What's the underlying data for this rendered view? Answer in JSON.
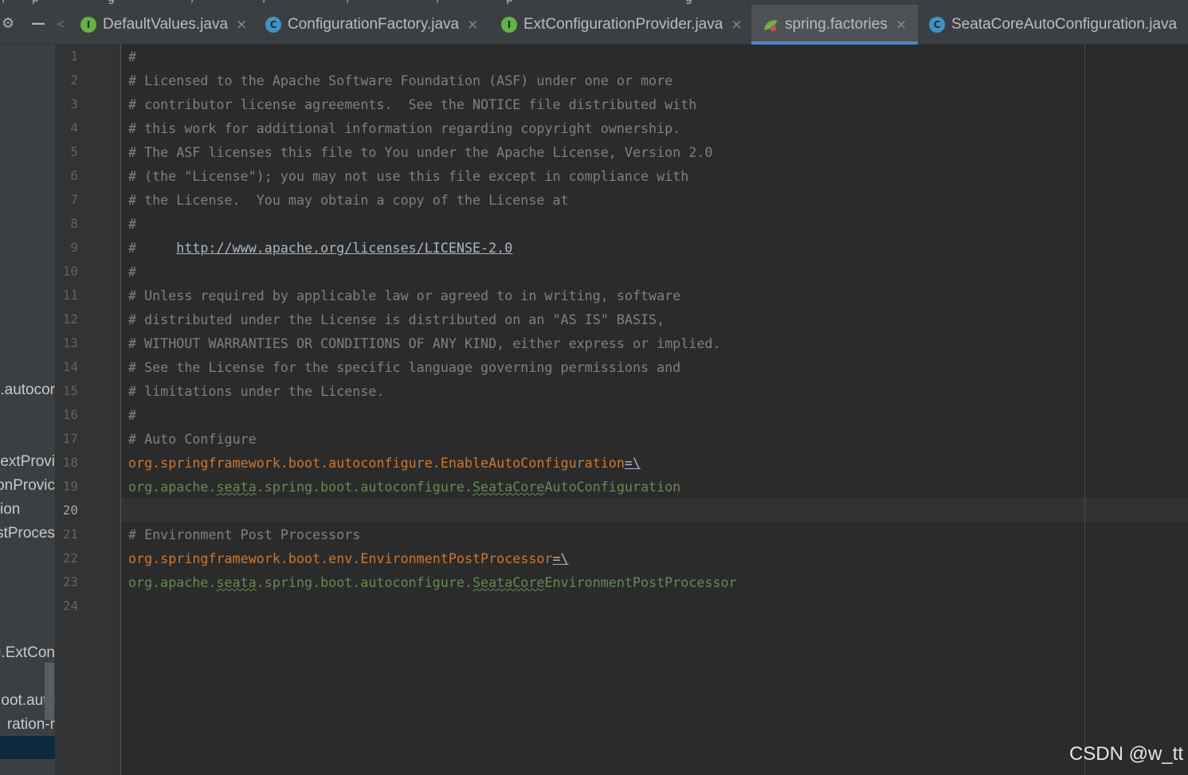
{
  "top_strip": [
    "/",
    "p",
    "g",
    "/",
    "/",
    "/",
    "/",
    "p",
    "g"
  ],
  "toolbar": {
    "settings_icon": "gear-icon",
    "collapse_icon": "minus-icon",
    "scroll_left_icon": "chevron-left-icon"
  },
  "tabs": [
    {
      "label": "DefaultValues.java",
      "icon": "I",
      "icon_color": "#62b543",
      "active": false
    },
    {
      "label": "ConfigurationFactory.java",
      "icon": "C",
      "icon_color": "#3d95c7",
      "active": false
    },
    {
      "label": "ExtConfigurationProvider.java",
      "icon": "I",
      "icon_color": "#62b543",
      "active": false
    },
    {
      "label": "spring.factories",
      "icon": "leaf",
      "icon_color": "#6db33f",
      "active": true
    },
    {
      "label": "SeataCoreAutoConfiguration.java",
      "icon": "C",
      "icon_color": "#3d95c7",
      "active": false
    }
  ],
  "close_glyph": "×",
  "sidebar": {
    "items": [
      {
        "text": ".autocor"
      },
      {
        "text": "extProvi"
      },
      {
        "text": "onProvic"
      },
      {
        "text": "ion"
      },
      {
        "text": "stProces"
      },
      {
        "text": "g.ExtCon"
      },
      {
        "text": "oot.autc"
      },
      {
        "text": "ration-r"
      }
    ]
  },
  "editor": {
    "current_line": 20,
    "line_numbers": [
      "1",
      "2",
      "3",
      "4",
      "5",
      "6",
      "7",
      "8",
      "9",
      "10",
      "11",
      "12",
      "13",
      "14",
      "15",
      "16",
      "17",
      "18",
      "19",
      "20",
      "21",
      "22",
      "23",
      "24"
    ],
    "lines": [
      {
        "segments": [
          {
            "t": "#",
            "c": "cm"
          }
        ]
      },
      {
        "segments": [
          {
            "t": "# Licensed to the Apache Software Foundation (ASF) under one or more",
            "c": "cm"
          }
        ]
      },
      {
        "segments": [
          {
            "t": "# contributor license agreements.  See the NOTICE file distributed with",
            "c": "cm"
          }
        ]
      },
      {
        "segments": [
          {
            "t": "# this work for additional information regarding copyright ownership.",
            "c": "cm"
          }
        ]
      },
      {
        "segments": [
          {
            "t": "# The ASF licenses this file to You under the Apache License, Version 2.0",
            "c": "cm"
          }
        ]
      },
      {
        "segments": [
          {
            "t": "# (the \"License\"); you may not use this file except in compliance with",
            "c": "cm"
          }
        ]
      },
      {
        "segments": [
          {
            "t": "# the License.  You may obtain a copy of the License at",
            "c": "cm"
          }
        ]
      },
      {
        "segments": [
          {
            "t": "#",
            "c": "cm"
          }
        ]
      },
      {
        "segments": [
          {
            "t": "#     ",
            "c": "cm"
          },
          {
            "t": "http://www.apache.org/licenses/LICENSE-2.0",
            "c": "url"
          }
        ]
      },
      {
        "segments": [
          {
            "t": "#",
            "c": "cm"
          }
        ]
      },
      {
        "segments": [
          {
            "t": "# Unless required by applicable law or agreed to in writing, software",
            "c": "cm"
          }
        ]
      },
      {
        "segments": [
          {
            "t": "# distributed under the License is distributed on an \"AS IS\" BASIS,",
            "c": "cm"
          }
        ]
      },
      {
        "segments": [
          {
            "t": "# WITHOUT WARRANTIES OR CONDITIONS OF ANY KIND, either express or implied.",
            "c": "cm"
          }
        ]
      },
      {
        "segments": [
          {
            "t": "# See the License for the specific language governing permissions and",
            "c": "cm"
          }
        ]
      },
      {
        "segments": [
          {
            "t": "# limitations under the License.",
            "c": "cm"
          }
        ]
      },
      {
        "segments": [
          {
            "t": "#",
            "c": "cm"
          }
        ]
      },
      {
        "segments": [
          {
            "t": "# Auto Configure",
            "c": "cm"
          }
        ]
      },
      {
        "segments": [
          {
            "t": "org.springframework.boot.autoconfigure.EnableAutoConfiguration",
            "c": "pkg"
          },
          {
            "t": "=\\",
            "c": "url"
          }
        ]
      },
      {
        "segments": [
          {
            "t": "org.apache.",
            "c": "pkg2"
          },
          {
            "t": "seata",
            "c": "pkg2 wavy"
          },
          {
            "t": ".spring.boot.autoconfigure.",
            "c": "pkg2"
          },
          {
            "t": "SeataCore",
            "c": "pkg2 wavy"
          },
          {
            "t": "AutoConfiguration",
            "c": "pkg2"
          }
        ]
      },
      {
        "segments": []
      },
      {
        "segments": [
          {
            "t": "# Environment Post Processors",
            "c": "cm"
          }
        ]
      },
      {
        "segments": [
          {
            "t": "org.springframework.boot.env.EnvironmentPostProcessor",
            "c": "pkg"
          },
          {
            "t": "=\\",
            "c": "url"
          }
        ]
      },
      {
        "segments": [
          {
            "t": "org.apache.",
            "c": "pkg2"
          },
          {
            "t": "seata",
            "c": "pkg2 wavy"
          },
          {
            "t": ".spring.boot.autoconfigure.",
            "c": "pkg2"
          },
          {
            "t": "SeataCore",
            "c": "pkg2 wavy"
          },
          {
            "t": "EnvironmentPostProcessor",
            "c": "pkg2"
          }
        ]
      },
      {
        "segments": []
      }
    ]
  },
  "watermark": "CSDN @w_tt"
}
